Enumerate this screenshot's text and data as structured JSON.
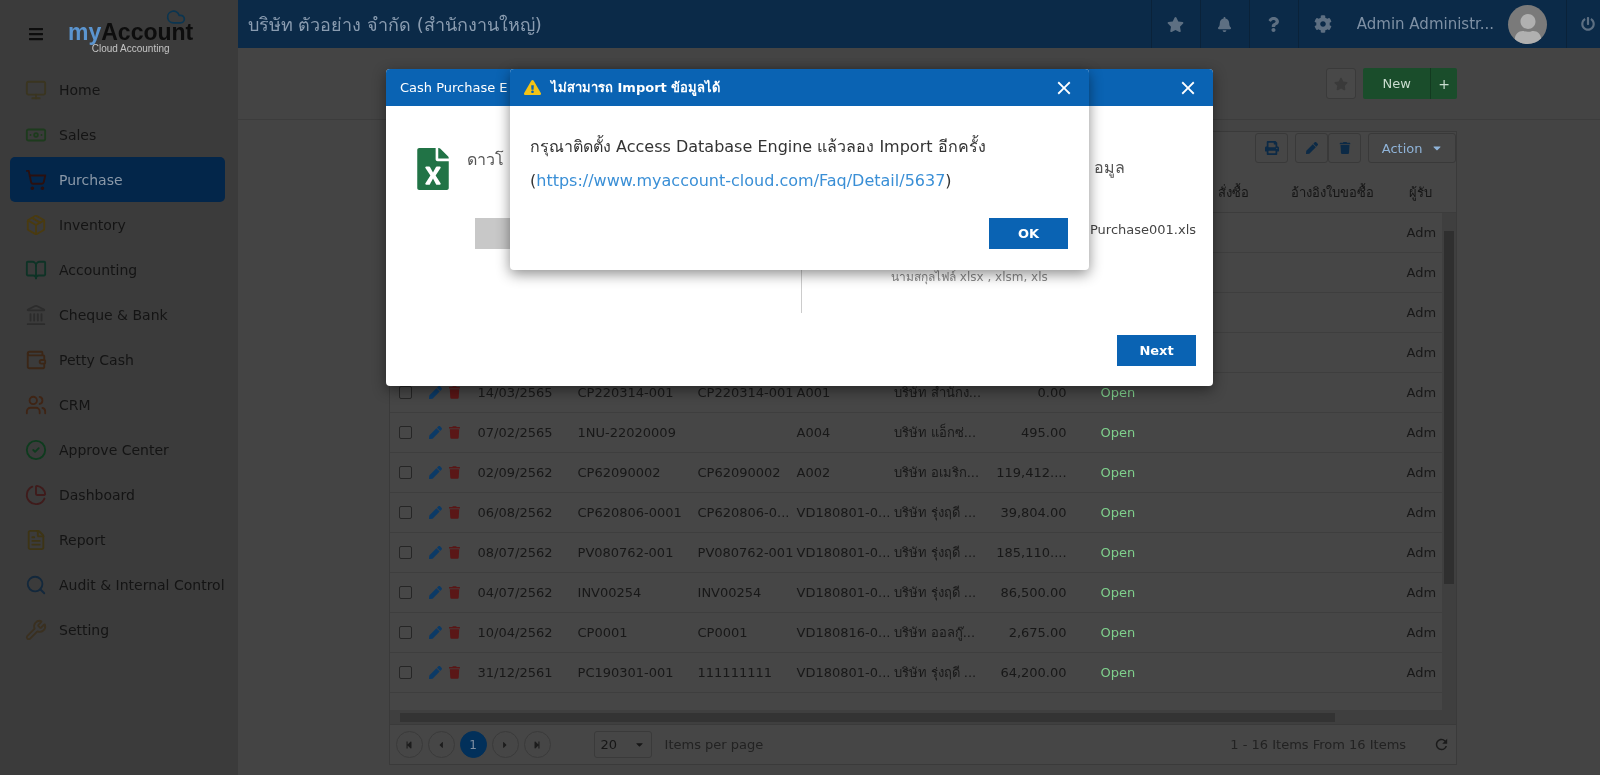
{
  "header": {
    "company": "บริษัท ตัวอย่าง จำกัด (สำนักงานใหญ่)",
    "user": "Admin Administr..."
  },
  "logo": {
    "accent": "my",
    "rest": "Account",
    "tagline": "Cloud Accounting"
  },
  "sidebar": {
    "items": [
      {
        "label": "Home",
        "selected": false
      },
      {
        "label": "Sales",
        "selected": false
      },
      {
        "label": "Purchase",
        "selected": true
      },
      {
        "label": "Inventory",
        "selected": false
      },
      {
        "label": "Accounting",
        "selected": false
      },
      {
        "label": "Cheque & Bank",
        "selected": false
      },
      {
        "label": "Petty Cash",
        "selected": false
      },
      {
        "label": "CRM",
        "selected": false
      },
      {
        "label": "Approve Center",
        "selected": false
      },
      {
        "label": "Dashboard",
        "selected": false
      },
      {
        "label": "Report",
        "selected": false
      },
      {
        "label": "Audit & Internal Control",
        "selected": false
      },
      {
        "label": "Setting",
        "selected": false
      }
    ]
  },
  "toolbar": {
    "new_button": "New",
    "add_button": "+"
  },
  "card_actions": {
    "action_button": "Action"
  },
  "table": {
    "columns": [
      {
        "label": "สั่งซื้อ"
      },
      {
        "label": "อ้างอิงใบขอซื้อ"
      },
      {
        "label": "ผู้รับ"
      }
    ],
    "rows": [
      {
        "kind": "covered",
        "column_12": "Adm"
      },
      {
        "kind": "covered",
        "column_12": "Adm"
      },
      {
        "kind": "covered",
        "column_12": "Adm"
      },
      {
        "kind": "covered",
        "column_12": "Adm"
      },
      {
        "kind": "record",
        "checked": false,
        "column_3": "14/03/2565",
        "column_4": "CP220314-001",
        "column_5": "CP220314-001",
        "column_6": "A001",
        "column_7": "บริษัท สำนักง...",
        "column_8": "0.00",
        "column_9": "Open",
        "column_12": "Adm"
      },
      {
        "kind": "record",
        "checked": false,
        "column_3": "07/02/2565",
        "column_4": "1NU-22020009",
        "column_6": "A004",
        "column_7": "บริษัท แอ็กซ่...",
        "column_8": "495.00",
        "column_9": "Open",
        "column_12": "Adm"
      },
      {
        "kind": "record",
        "checked": false,
        "column_3": "02/09/2562",
        "column_4": "CP62090002",
        "column_5": "CP62090002",
        "column_6": "A002",
        "column_7": "บริษัท อเมริก...",
        "column_8": "119,412....",
        "column_9": "Open",
        "column_12": "Adm"
      },
      {
        "kind": "record",
        "checked": false,
        "column_3": "06/08/2562",
        "column_4": "CP620806-0001",
        "column_5": "CP620806-0...",
        "column_6": "VD180801-0...",
        "column_7": "บริษัท รุ่งฤดี ...",
        "column_8": "39,804.00",
        "column_9": "Open",
        "column_12": "Adm"
      },
      {
        "kind": "record",
        "checked": false,
        "column_3": "08/07/2562",
        "column_4": "PV080762-001",
        "column_5": "PV080762-001",
        "column_6": "VD180801-0...",
        "column_7": "บริษัท รุ่งฤดี ...",
        "column_8": "185,110....",
        "column_9": "Open",
        "column_12": "Adm"
      },
      {
        "kind": "record",
        "checked": false,
        "column_3": "04/07/2562",
        "column_4": "INV00254",
        "column_5": "INV00254",
        "column_6": "VD180801-0...",
        "column_7": "บริษัท รุ่งฤดี ...",
        "column_8": "86,500.00",
        "column_9": "Open",
        "column_12": "Adm"
      },
      {
        "kind": "record",
        "checked": false,
        "column_3": "10/04/2562",
        "column_4": "CP0001",
        "column_5": "CP0001",
        "column_6": "VD180816-0...",
        "column_7": "บริษัท ออลกู๊...",
        "column_8": "2,675.00",
        "column_9": "Open",
        "column_12": "Adm"
      },
      {
        "kind": "record",
        "checked": false,
        "column_3": "31/12/2561",
        "column_4": "PC190301-001",
        "column_5": "111111111",
        "column_6": "VD180801-0...",
        "column_7": "บริษัท รุ่งฤดี ...",
        "column_8": "64,200.00",
        "column_9": "Open",
        "column_12": "Adm"
      }
    ]
  },
  "pagination": {
    "pages": [
      {
        "label": "1",
        "selected": true
      }
    ],
    "page_size": "20",
    "page_size_label": "Items per page",
    "summary": "1 - 16 Items From 16 Items"
  },
  "import_dialog": {
    "title": "Cash Purchase E",
    "download_text": "ดาวโ",
    "upload_text": "อมูล",
    "file_name": "Purchase001.xls",
    "extensions_hint": "นามสกุลไฟล์ xlsx , xlsm, xls",
    "next_button": "Next"
  },
  "error_dialog": {
    "title": "ไม่สามารถ Import ข้อมูลได้",
    "message": "กรุณาติดตั้ง Access Database Engine แล้วลอง Import อีกครั้ง",
    "link_line": {
      "before": "(",
      "link": "https://www.myaccount-cloud.com/Faq/Detail/5637",
      "after": ")"
    },
    "ok_button": "OK"
  }
}
